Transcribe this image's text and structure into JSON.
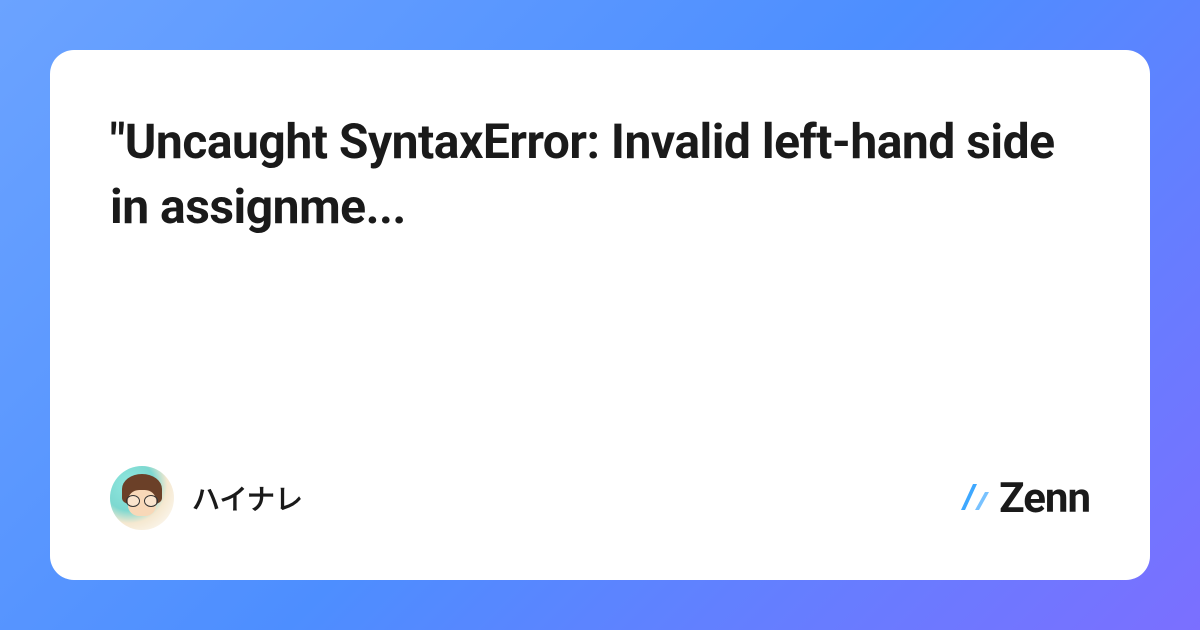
{
  "card": {
    "title": "\"Uncaught SyntaxError: Invalid left-hand side in assignme..."
  },
  "author": {
    "name": "ハイナレ"
  },
  "brand": {
    "name": "Zenn"
  }
}
